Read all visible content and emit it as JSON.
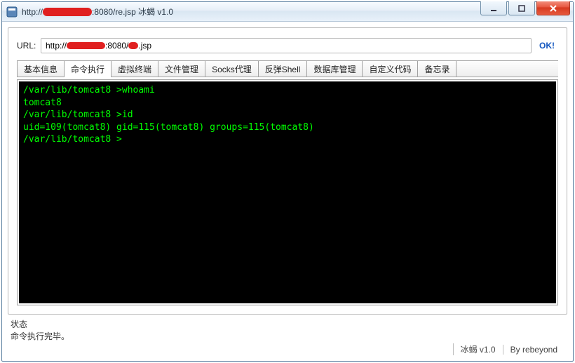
{
  "window": {
    "title_prefix": "http://",
    "title_suffix": ":8080/re.jsp    冰蝎 v1.0"
  },
  "url_bar": {
    "label": "URL:",
    "value_prefix": "http://",
    "value_mid": ":8080/",
    "value_suffix": ".jsp",
    "ok_label": "OK!"
  },
  "tabs": [
    {
      "label": "基本信息",
      "active": false
    },
    {
      "label": "命令执行",
      "active": true
    },
    {
      "label": "虚拟终端",
      "active": false
    },
    {
      "label": "文件管理",
      "active": false
    },
    {
      "label": "Socks代理",
      "active": false
    },
    {
      "label": "反弹Shell",
      "active": false
    },
    {
      "label": "数据库管理",
      "active": false
    },
    {
      "label": "自定义代码",
      "active": false
    },
    {
      "label": "备忘录",
      "active": false
    }
  ],
  "terminal": {
    "lines": [
      "/var/lib/tomcat8 >whoami",
      "tomcat8",
      "/var/lib/tomcat8 >id",
      "uid=109(tomcat8) gid=115(tomcat8) groups=115(tomcat8)",
      "/var/lib/tomcat8 >"
    ]
  },
  "status": {
    "label": "状态",
    "message": "命令执行完毕。",
    "version": "冰蝎 v1.0",
    "author": "By rebeyond"
  },
  "colors": {
    "terminal_bg": "#000000",
    "terminal_fg": "#00ff00",
    "redaction": "#e02020"
  }
}
